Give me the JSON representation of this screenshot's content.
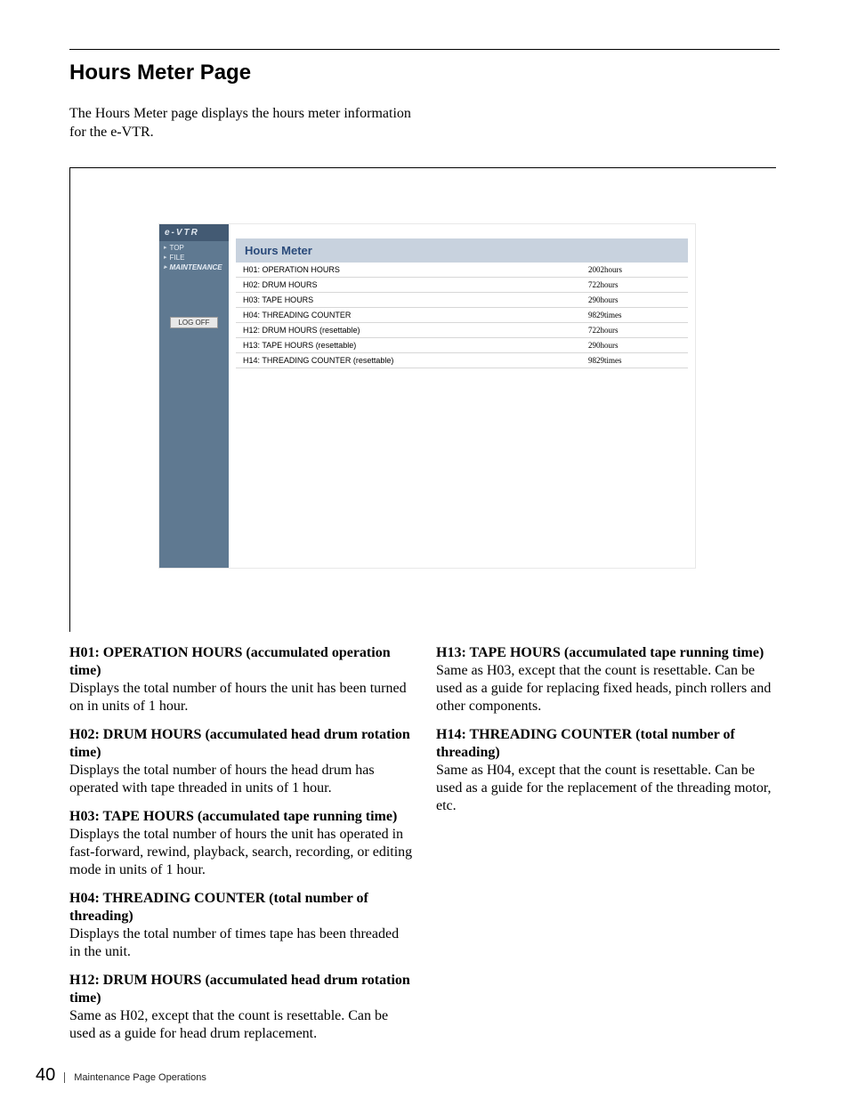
{
  "section_title": "Hours Meter Page",
  "intro": "The Hours Meter page displays the hours meter information for the e-VTR.",
  "shot": {
    "brand": "e-VTR",
    "nav": [
      {
        "label": "TOP"
      },
      {
        "label": "FILE"
      },
      {
        "label": "MAINTENANCE"
      }
    ],
    "logoff": "LOG OFF",
    "panel_title": "Hours Meter",
    "rows": [
      {
        "label": "H01: OPERATION HOURS",
        "value": "2002hours"
      },
      {
        "label": "H02: DRUM HOURS",
        "value": "722hours"
      },
      {
        "label": "H03: TAPE HOURS",
        "value": "290hours"
      },
      {
        "label": "H04: THREADING COUNTER",
        "value": "9829times"
      },
      {
        "label": "H12: DRUM HOURS (resettable)",
        "value": "722hours"
      },
      {
        "label": "H13: TAPE HOURS (resettable)",
        "value": "290hours"
      },
      {
        "label": "H14: THREADING COUNTER (resettable)",
        "value": "9829times"
      }
    ]
  },
  "desc_left": [
    {
      "h": "H01: OPERATION HOURS (accumulated operation time)",
      "p": "Displays the total number of hours the unit has been turned on in units of 1 hour."
    },
    {
      "h": "H02: DRUM HOURS (accumulated head drum rotation time)",
      "p": "Displays the total number of hours the head drum has operated with tape threaded in units of 1 hour."
    },
    {
      "h": "H03: TAPE HOURS (accumulated tape running time)",
      "p": "Displays the total number of hours the unit has operated in fast-forward, rewind, playback, search, recording, or editing mode in units of 1 hour."
    },
    {
      "h": "H04: THREADING COUNTER (total number of threading)",
      "p": "Displays the total number of times tape has been threaded in the unit."
    },
    {
      "h": "H12: DRUM HOURS (accumulated head drum rotation time)",
      "p": "Same as H02, except that the count is resettable. Can be used as a guide for head drum replacement."
    }
  ],
  "desc_right": [
    {
      "h": "H13: TAPE HOURS (accumulated tape running time)",
      "p": "Same as H03, except that the count is resettable. Can be used as a guide for replacing fixed heads, pinch rollers and other components."
    },
    {
      "h": "H14: THREADING COUNTER (total number of threading)",
      "p": "Same as H04, except that the count is resettable. Can be used as a guide for the replacement of the threading motor, etc."
    }
  ],
  "footer": {
    "page": "40",
    "label": "Maintenance Page Operations"
  }
}
